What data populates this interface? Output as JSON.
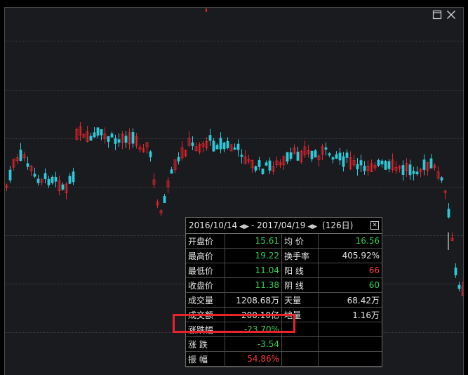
{
  "window": {
    "restore_icon": "restore-icon",
    "close_icon": "close-icon"
  },
  "chart_data": {
    "type": "candlestick",
    "colors": {
      "up": "#e8242b",
      "down": "#2fc8d8",
      "grid": "#3a3b40"
    }
  },
  "stats": {
    "start_date": "2016/10/14",
    "end_date": "2017/04/19",
    "period": "(126日)",
    "rows": [
      {
        "l1": "开盘价",
        "v1": "15.61",
        "c1": "green",
        "l2": "均  价",
        "v2": "16.56",
        "c2": "green"
      },
      {
        "l1": "最高价",
        "v1": "19.22",
        "c1": "green",
        "l2": "换手率",
        "v2": "405.92%",
        "c2": "white"
      },
      {
        "l1": "最低价",
        "v1": "11.04",
        "c1": "green",
        "l2": "阳  线",
        "v2": "66",
        "c2": "red"
      },
      {
        "l1": "收盘价",
        "v1": "11.38",
        "c1": "green",
        "l2": "阴  线",
        "v2": "60",
        "c2": "green"
      },
      {
        "l1": "成交量",
        "v1": "1208.68万",
        "c1": "white",
        "l2": "天量",
        "v2": "68.42万",
        "c2": "white"
      },
      {
        "l1": "成交额",
        "v1": "200.10亿",
        "c1": "white",
        "l2": "地量",
        "v2": "1.16万",
        "c2": "white"
      },
      {
        "l1": "涨跌幅",
        "v1": "-23.70%",
        "c1": "green",
        "l2": "",
        "v2": "",
        "c2": "white"
      },
      {
        "l1": "涨  跌",
        "v1": "-3.54",
        "c1": "green",
        "l2": "",
        "v2": "",
        "c2": "white"
      },
      {
        "l1": "振  幅",
        "v1": "54.86%",
        "c1": "red",
        "l2": "",
        "v2": "",
        "c2": "white"
      }
    ]
  }
}
